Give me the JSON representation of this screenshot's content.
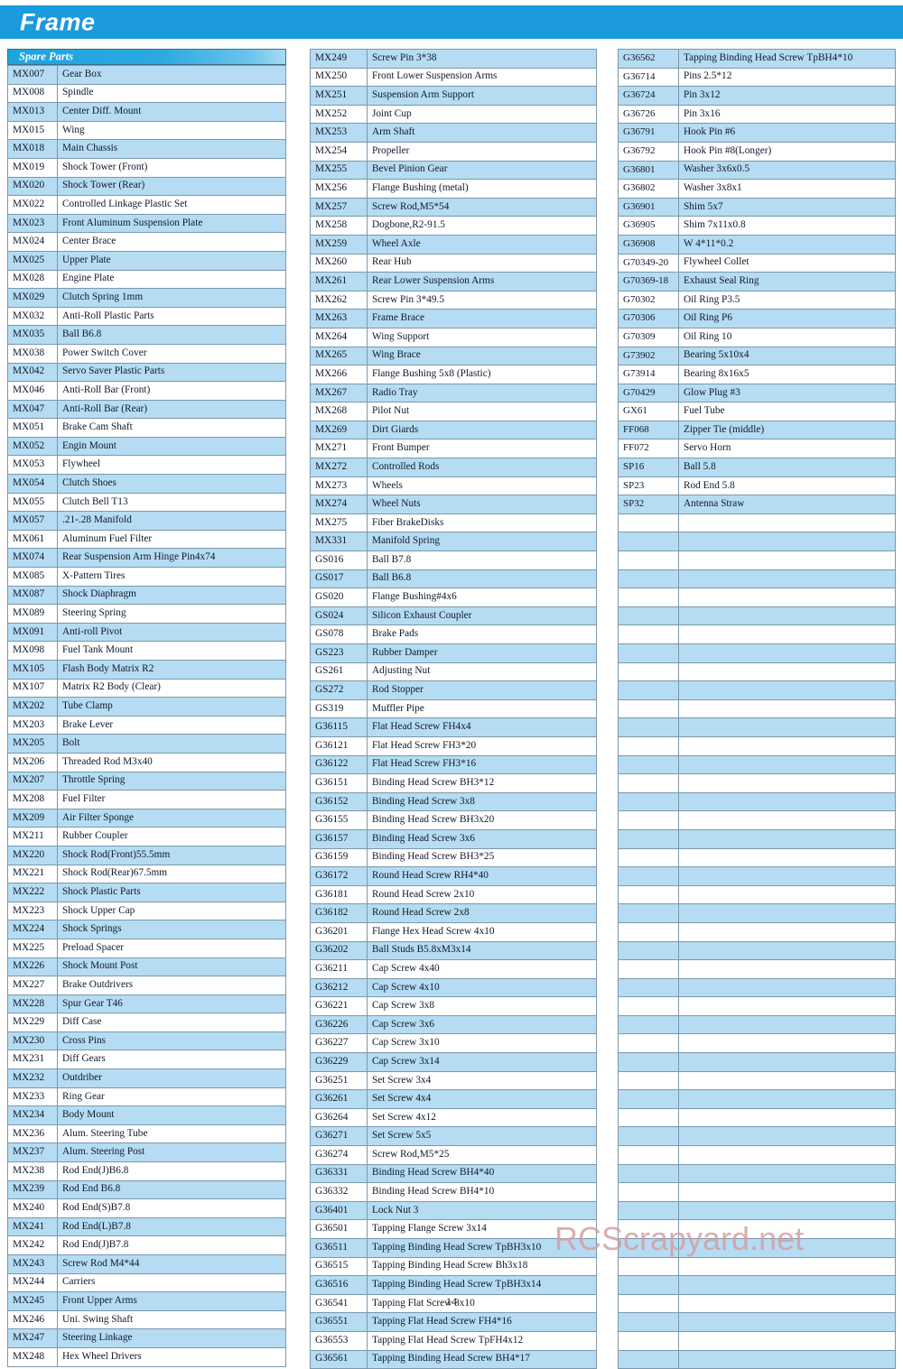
{
  "banner": {
    "title": "Frame"
  },
  "section": {
    "header_label": "Spare Parts"
  },
  "table": {
    "col_code_header": "",
    "col_desc_header": ""
  },
  "watermark": {
    "text": "RCScrapyard.net"
  },
  "footer": {
    "page_number": "14"
  },
  "colors": {
    "banner_blue": "#1b9ade",
    "header_gradient_start": "#1fa3e0",
    "header_gradient_end": "#a7dcf4",
    "row_alt": "#b5dcf3",
    "row_norm": "#ffffff",
    "border": "#7b98ad",
    "watermark": "#d4a0a4"
  },
  "columns": [
    {
      "name": "column-1",
      "rows": [
        {
          "code": "MX007",
          "desc": "Gear Box"
        },
        {
          "code": "MX008",
          "desc": "Spindle"
        },
        {
          "code": "MX013",
          "desc": "Center Diff. Mount"
        },
        {
          "code": "MX015",
          "desc": "Wing"
        },
        {
          "code": "MX018",
          "desc": "Main Chassis"
        },
        {
          "code": "MX019",
          "desc": "Shock Tower (Front)"
        },
        {
          "code": "MX020",
          "desc": "Shock Tower (Rear)"
        },
        {
          "code": "MX022",
          "desc": "Controlled Linkage Plastic Set"
        },
        {
          "code": "MX023",
          "desc": "Front Aluminum Suspension Plate"
        },
        {
          "code": "MX024",
          "desc": "Center Brace"
        },
        {
          "code": "MX025",
          "desc": "Upper Plate"
        },
        {
          "code": "MX028",
          "desc": "Engine Plate"
        },
        {
          "code": "MX029",
          "desc": "Clutch Spring 1mm"
        },
        {
          "code": "MX032",
          "desc": "Anti-Roll Plastic Parts"
        },
        {
          "code": "MX035",
          "desc": "Ball B6.8"
        },
        {
          "code": "MX038",
          "desc": "Power Switch Cover"
        },
        {
          "code": "MX042",
          "desc": "Servo Saver Plastic Parts"
        },
        {
          "code": "MX046",
          "desc": "Anti-Roll Bar (Front)"
        },
        {
          "code": "MX047",
          "desc": "Anti-Roll Bar (Rear)"
        },
        {
          "code": "MX051",
          "desc": "Brake Cam Shaft"
        },
        {
          "code": "MX052",
          "desc": "Engin Mount"
        },
        {
          "code": "MX053",
          "desc": "Flywheel"
        },
        {
          "code": "MX054",
          "desc": "Clutch Shoes"
        },
        {
          "code": "MX055",
          "desc": "Clutch Bell T13"
        },
        {
          "code": "MX057",
          "desc": ".21-.28 Manifold"
        },
        {
          "code": "MX061",
          "desc": "Aluminum Fuel Filter"
        },
        {
          "code": "MX074",
          "desc": "Rear Suspension Arm Hinge Pin4x74"
        },
        {
          "code": "MX085",
          "desc": "X-Pattern Tires"
        },
        {
          "code": "MX087",
          "desc": "Shock Diaphragm"
        },
        {
          "code": "MX089",
          "desc": "Steering Spring"
        },
        {
          "code": "MX091",
          "desc": "Anti-roll Pivot"
        },
        {
          "code": "MX098",
          "desc": "Fuel Tank Mount"
        },
        {
          "code": "MX105",
          "desc": "Flash Body Matrix R2"
        },
        {
          "code": "MX107",
          "desc": "Matrix R2 Body (Clear)"
        },
        {
          "code": "MX202",
          "desc": "Tube Clamp"
        },
        {
          "code": "MX203",
          "desc": "Brake Lever"
        },
        {
          "code": "MX205",
          "desc": "Bolt"
        },
        {
          "code": "MX206",
          "desc": "Threaded Rod M3x40"
        },
        {
          "code": "MX207",
          "desc": "Throttle Spring"
        },
        {
          "code": "MX208",
          "desc": " Fuel Filter"
        },
        {
          "code": "MX209",
          "desc": "Air Filter Sponge"
        },
        {
          "code": "MX211",
          "desc": "Rubber Coupler"
        },
        {
          "code": "MX220",
          "desc": "Shock Rod(Front)55.5mm"
        },
        {
          "code": "MX221",
          "desc": "Shock Rod(Rear)67.5mm"
        },
        {
          "code": "MX222",
          "desc": "Shock Plastic Parts"
        },
        {
          "code": "MX223",
          "desc": "Shock Upper Cap"
        },
        {
          "code": "MX224",
          "desc": "Shock Springs"
        },
        {
          "code": "MX225",
          "desc": "Preload Spacer"
        },
        {
          "code": "MX226",
          "desc": "Shock Mount Post"
        },
        {
          "code": "MX227",
          "desc": "Brake Outdrivers"
        },
        {
          "code": "MX228",
          "desc": "Spur Gear T46"
        },
        {
          "code": "MX229",
          "desc": "Diff Case"
        },
        {
          "code": "MX230",
          "desc": "Cross Pins"
        },
        {
          "code": "MX231",
          "desc": "Diff Gears"
        },
        {
          "code": "MX232",
          "desc": "Outdriber"
        },
        {
          "code": "MX233",
          "desc": "Ring Gear"
        },
        {
          "code": "MX234",
          "desc": "Body Mount"
        },
        {
          "code": "MX236",
          "desc": "Alum. Steering Tube"
        },
        {
          "code": "MX237",
          "desc": "Alum. Steering Post"
        },
        {
          "code": "MX238",
          "desc": "Rod End(J)B6.8"
        },
        {
          "code": "MX239",
          "desc": "Rod End B6.8"
        },
        {
          "code": "MX240",
          "desc": "Rod End(S)B7.8"
        },
        {
          "code": "MX241",
          "desc": "Rod End(L)B7.8"
        },
        {
          "code": "MX242",
          "desc": "Rod End(J)B7.8"
        },
        {
          "code": "MX243",
          "desc": "Screw Rod M4*44"
        },
        {
          "code": "MX244",
          "desc": "Carriers"
        },
        {
          "code": "MX245",
          "desc": "Front Upper Arms"
        },
        {
          "code": "MX246",
          "desc": "Uni. Swing Shaft"
        },
        {
          "code": "MX247",
          "desc": "Steering Linkage"
        },
        {
          "code": "MX248",
          "desc": "Hex Wheel Drivers"
        }
      ]
    },
    {
      "name": "column-2",
      "rows": [
        {
          "code": "MX249",
          "desc": "Screw Pin 3*38"
        },
        {
          "code": "MX250",
          "desc": "Front Lower Suspension Arms"
        },
        {
          "code": "MX251",
          "desc": "Suspension Arm Support"
        },
        {
          "code": "MX252",
          "desc": "Joint Cup"
        },
        {
          "code": "MX253",
          "desc": "Arm Shaft"
        },
        {
          "code": "MX254",
          "desc": "Propeller"
        },
        {
          "code": "MX255",
          "desc": "Bevel Pinion Gear"
        },
        {
          "code": "MX256",
          "desc": "Flange Bushing (metal)"
        },
        {
          "code": "MX257",
          "desc": "Screw Rod,M5*54"
        },
        {
          "code": "MX258",
          "desc": "Dogbone,R2-91.5"
        },
        {
          "code": "MX259",
          "desc": "Wheel Axle"
        },
        {
          "code": "MX260",
          "desc": "Rear Hub"
        },
        {
          "code": "MX261",
          "desc": "Rear Lower Suspension Arms"
        },
        {
          "code": "MX262",
          "desc": "Screw Pin 3*49.5"
        },
        {
          "code": "MX263",
          "desc": "Frame Brace"
        },
        {
          "code": "MX264",
          "desc": "Wing Support"
        },
        {
          "code": "MX265",
          "desc": "Wing Brace"
        },
        {
          "code": "MX266",
          "desc": "Flange Bushing 5x8 (Plastic)"
        },
        {
          "code": "MX267",
          "desc": " Radio Tray"
        },
        {
          "code": "MX268",
          "desc": "Pilot Nut"
        },
        {
          "code": "MX269",
          "desc": "Dirt Giards"
        },
        {
          "code": "MX271",
          "desc": "Front Bumper"
        },
        {
          "code": "MX272",
          "desc": "Controlled Rods"
        },
        {
          "code": "MX273",
          "desc": "Wheels"
        },
        {
          "code": "MX274",
          "desc": "Wheel Nuts"
        },
        {
          "code": "MX275",
          "desc": " Fiber BrakeDisks"
        },
        {
          "code": "MX331",
          "desc": "Manifold Spring"
        },
        {
          "code": "GS016",
          "desc": "Ball B7.8"
        },
        {
          "code": "GS017",
          "desc": "Ball B6.8"
        },
        {
          "code": "GS020",
          "desc": "Flange Bushing#4x6"
        },
        {
          "code": "GS024",
          "desc": "Silicon Exhaust Coupler"
        },
        {
          "code": "GS078",
          "desc": "Brake Pads"
        },
        {
          "code": "GS223",
          "desc": "Rubber  Damper"
        },
        {
          "code": "GS261",
          "desc": "Adjusting Nut"
        },
        {
          "code": "GS272",
          "desc": "Rod Stopper"
        },
        {
          "code": "GS319",
          "desc": "Muffler Pipe"
        },
        {
          "code": "G36115",
          "desc": "Flat Head Screw FH4x4"
        },
        {
          "code": "G36121",
          "desc": "Flat Head Screw FH3*20"
        },
        {
          "code": "G36122",
          "desc": "Flat Head Screw FH3*16"
        },
        {
          "code": "G36151",
          "desc": "Binding Head Screw BH3*12"
        },
        {
          "code": "G36152",
          "desc": "Binding Head Screw 3x8"
        },
        {
          "code": "G36155",
          "desc": "Binding Head Screw BH3x20"
        },
        {
          "code": "G36157",
          "desc": "Binding Head Screw 3x6"
        },
        {
          "code": "G36159",
          "desc": "Binding Head Screw BH3*25"
        },
        {
          "code": "G36172",
          "desc": "Round Head Screw RH4*40"
        },
        {
          "code": "G36181",
          "desc": "Round Head Screw 2x10"
        },
        {
          "code": "G36182",
          "desc": "Round Head Screw 2x8"
        },
        {
          "code": "G36201",
          "desc": "Flange Hex Head Screw 4x10"
        },
        {
          "code": "G36202",
          "desc": "Ball Studs B5.8xM3x14"
        },
        {
          "code": "G36211",
          "desc": "Cap Screw 4x40"
        },
        {
          "code": "G36212",
          "desc": "Cap Screw 4x10"
        },
        {
          "code": "G36221",
          "desc": "Cap Screw 3x8"
        },
        {
          "code": "G36226",
          "desc": "Cap Screw 3x6"
        },
        {
          "code": "G36227",
          "desc": "Cap Screw 3x10"
        },
        {
          "code": "G36229",
          "desc": "Cap Screw 3x14"
        },
        {
          "code": "G36251",
          "desc": "Set Screw 3x4"
        },
        {
          "code": "G36261",
          "desc": "Set Screw 4x4"
        },
        {
          "code": "G36264",
          "desc": "Set Screw 4x12"
        },
        {
          "code": "G36271",
          "desc": "Set Screw 5x5"
        },
        {
          "code": "G36274",
          "desc": "Screw Rod,M5*25"
        },
        {
          "code": "G36331",
          "desc": "Binding Head Screw BH4*40"
        },
        {
          "code": "G36332",
          "desc": "Binding Head Screw BH4*10"
        },
        {
          "code": "G36401",
          "desc": "Lock Nut 3"
        },
        {
          "code": "G36501",
          "desc": "Tapping Flange Screw 3x14"
        },
        {
          "code": "G36511",
          "desc": "Tapping Binding Head Screw TpBH3x10"
        },
        {
          "code": "G36515",
          "desc": "Tapping Binding Head Screw Bh3x18"
        },
        {
          "code": "G36516",
          "desc": "Tapping Binding Head Screw TpBH3x14"
        },
        {
          "code": "G36541",
          "desc": "Tapping Flat Screw 3x10"
        },
        {
          "code": "G36551",
          "desc": "Tapping Flat Head Screw FH4*16"
        },
        {
          "code": "G36553",
          "desc": "Tapping Flat Head Screw TpFH4x12"
        },
        {
          "code": "G36561",
          "desc": "Tapping Binding Head Screw BH4*17"
        }
      ]
    },
    {
      "name": "column-3",
      "rows": [
        {
          "code": "G36562",
          "desc": "Tapping Binding Head Screw TpBH4*10"
        },
        {
          "code": "G36714",
          "desc": "Pins 2.5*12"
        },
        {
          "code": "G36724",
          "desc": "Pin 3x12"
        },
        {
          "code": "G36726",
          "desc": "Pin 3x16"
        },
        {
          "code": "G36791",
          "desc": "Hook Pin #6"
        },
        {
          "code": "G36792",
          "desc": "Hook Pin #8(Longer)"
        },
        {
          "code": "G36801",
          "desc": "Washer 3x6x0.5"
        },
        {
          "code": "G36802",
          "desc": "Washer 3x8x1"
        },
        {
          "code": "G36901",
          "desc": "Shim 5x7"
        },
        {
          "code": "G36905",
          "desc": "Shim 7x11x0.8"
        },
        {
          "code": "G36908",
          "desc": "W 4*11*0.2"
        },
        {
          "code": "G70349-20",
          "desc": "Flywheel Collet"
        },
        {
          "code": "G70369-18",
          "desc": "Exhaust Seal Ring"
        },
        {
          "code": "G70302",
          "desc": "Oil Ring P3.5"
        },
        {
          "code": "G70306",
          "desc": "Oil Ring P6"
        },
        {
          "code": "G70309",
          "desc": "Oil Ring 10"
        },
        {
          "code": "G73902",
          "desc": "Bearing 5x10x4"
        },
        {
          "code": "G73914",
          "desc": "Bearing 8x16x5"
        },
        {
          "code": "G70429",
          "desc": "Glow Plug #3"
        },
        {
          "code": "GX61",
          "desc": "Fuel Tube"
        },
        {
          "code": "FF068",
          "desc": "Zipper Tie (middle)"
        },
        {
          "code": "FF072",
          "desc": "Servo Horn"
        },
        {
          "code": "SP16",
          "desc": "Ball 5.8"
        },
        {
          "code": "SP23",
          "desc": "Rod End 5.8"
        },
        {
          "code": "SP32",
          "desc": "Antenna Straw"
        },
        {
          "code": "",
          "desc": ""
        },
        {
          "code": "",
          "desc": ""
        },
        {
          "code": "",
          "desc": ""
        },
        {
          "code": "",
          "desc": ""
        },
        {
          "code": "",
          "desc": ""
        },
        {
          "code": "",
          "desc": ""
        },
        {
          "code": "",
          "desc": ""
        },
        {
          "code": "",
          "desc": ""
        },
        {
          "code": "",
          "desc": ""
        },
        {
          "code": "",
          "desc": ""
        },
        {
          "code": "",
          "desc": ""
        },
        {
          "code": "",
          "desc": ""
        },
        {
          "code": "",
          "desc": ""
        },
        {
          "code": "",
          "desc": ""
        },
        {
          "code": "",
          "desc": ""
        },
        {
          "code": "",
          "desc": ""
        },
        {
          "code": "",
          "desc": ""
        },
        {
          "code": "",
          "desc": ""
        },
        {
          "code": "",
          "desc": ""
        },
        {
          "code": "",
          "desc": ""
        },
        {
          "code": "",
          "desc": ""
        },
        {
          "code": "",
          "desc": ""
        },
        {
          "code": "",
          "desc": ""
        },
        {
          "code": "",
          "desc": ""
        },
        {
          "code": "",
          "desc": ""
        },
        {
          "code": "",
          "desc": ""
        },
        {
          "code": "",
          "desc": ""
        },
        {
          "code": "",
          "desc": ""
        },
        {
          "code": "",
          "desc": ""
        },
        {
          "code": "",
          "desc": ""
        },
        {
          "code": "",
          "desc": ""
        },
        {
          "code": "",
          "desc": ""
        },
        {
          "code": "",
          "desc": ""
        },
        {
          "code": "",
          "desc": ""
        },
        {
          "code": "",
          "desc": ""
        },
        {
          "code": "",
          "desc": ""
        },
        {
          "code": "",
          "desc": ""
        },
        {
          "code": "",
          "desc": ""
        },
        {
          "code": "",
          "desc": ""
        },
        {
          "code": "",
          "desc": ""
        },
        {
          "code": "",
          "desc": ""
        },
        {
          "code": "",
          "desc": ""
        },
        {
          "code": "",
          "desc": ""
        },
        {
          "code": "",
          "desc": ""
        },
        {
          "code": "",
          "desc": ""
        },
        {
          "code": "",
          "desc": ""
        }
      ]
    }
  ]
}
